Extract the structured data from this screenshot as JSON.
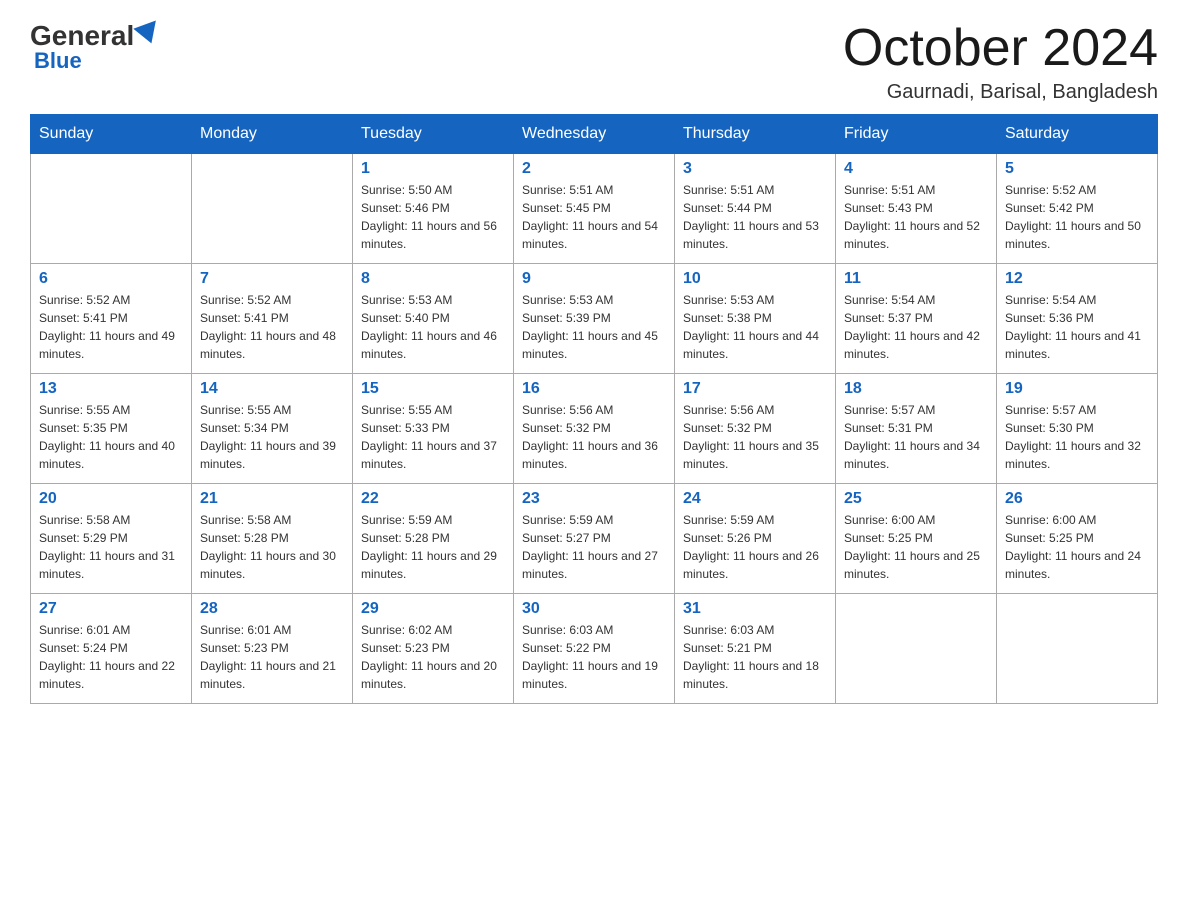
{
  "header": {
    "logo": {
      "general": "General",
      "blue": "Blue"
    },
    "title": "October 2024",
    "location": "Gaurnadi, Barisal, Bangladesh"
  },
  "weekdays": [
    "Sunday",
    "Monday",
    "Tuesday",
    "Wednesday",
    "Thursday",
    "Friday",
    "Saturday"
  ],
  "weeks": [
    [
      {
        "day": "",
        "sunrise": "",
        "sunset": "",
        "daylight": ""
      },
      {
        "day": "",
        "sunrise": "",
        "sunset": "",
        "daylight": ""
      },
      {
        "day": "1",
        "sunrise": "Sunrise: 5:50 AM",
        "sunset": "Sunset: 5:46 PM",
        "daylight": "Daylight: 11 hours and 56 minutes."
      },
      {
        "day": "2",
        "sunrise": "Sunrise: 5:51 AM",
        "sunset": "Sunset: 5:45 PM",
        "daylight": "Daylight: 11 hours and 54 minutes."
      },
      {
        "day": "3",
        "sunrise": "Sunrise: 5:51 AM",
        "sunset": "Sunset: 5:44 PM",
        "daylight": "Daylight: 11 hours and 53 minutes."
      },
      {
        "day": "4",
        "sunrise": "Sunrise: 5:51 AM",
        "sunset": "Sunset: 5:43 PM",
        "daylight": "Daylight: 11 hours and 52 minutes."
      },
      {
        "day": "5",
        "sunrise": "Sunrise: 5:52 AM",
        "sunset": "Sunset: 5:42 PM",
        "daylight": "Daylight: 11 hours and 50 minutes."
      }
    ],
    [
      {
        "day": "6",
        "sunrise": "Sunrise: 5:52 AM",
        "sunset": "Sunset: 5:41 PM",
        "daylight": "Daylight: 11 hours and 49 minutes."
      },
      {
        "day": "7",
        "sunrise": "Sunrise: 5:52 AM",
        "sunset": "Sunset: 5:41 PM",
        "daylight": "Daylight: 11 hours and 48 minutes."
      },
      {
        "day": "8",
        "sunrise": "Sunrise: 5:53 AM",
        "sunset": "Sunset: 5:40 PM",
        "daylight": "Daylight: 11 hours and 46 minutes."
      },
      {
        "day": "9",
        "sunrise": "Sunrise: 5:53 AM",
        "sunset": "Sunset: 5:39 PM",
        "daylight": "Daylight: 11 hours and 45 minutes."
      },
      {
        "day": "10",
        "sunrise": "Sunrise: 5:53 AM",
        "sunset": "Sunset: 5:38 PM",
        "daylight": "Daylight: 11 hours and 44 minutes."
      },
      {
        "day": "11",
        "sunrise": "Sunrise: 5:54 AM",
        "sunset": "Sunset: 5:37 PM",
        "daylight": "Daylight: 11 hours and 42 minutes."
      },
      {
        "day": "12",
        "sunrise": "Sunrise: 5:54 AM",
        "sunset": "Sunset: 5:36 PM",
        "daylight": "Daylight: 11 hours and 41 minutes."
      }
    ],
    [
      {
        "day": "13",
        "sunrise": "Sunrise: 5:55 AM",
        "sunset": "Sunset: 5:35 PM",
        "daylight": "Daylight: 11 hours and 40 minutes."
      },
      {
        "day": "14",
        "sunrise": "Sunrise: 5:55 AM",
        "sunset": "Sunset: 5:34 PM",
        "daylight": "Daylight: 11 hours and 39 minutes."
      },
      {
        "day": "15",
        "sunrise": "Sunrise: 5:55 AM",
        "sunset": "Sunset: 5:33 PM",
        "daylight": "Daylight: 11 hours and 37 minutes."
      },
      {
        "day": "16",
        "sunrise": "Sunrise: 5:56 AM",
        "sunset": "Sunset: 5:32 PM",
        "daylight": "Daylight: 11 hours and 36 minutes."
      },
      {
        "day": "17",
        "sunrise": "Sunrise: 5:56 AM",
        "sunset": "Sunset: 5:32 PM",
        "daylight": "Daylight: 11 hours and 35 minutes."
      },
      {
        "day": "18",
        "sunrise": "Sunrise: 5:57 AM",
        "sunset": "Sunset: 5:31 PM",
        "daylight": "Daylight: 11 hours and 34 minutes."
      },
      {
        "day": "19",
        "sunrise": "Sunrise: 5:57 AM",
        "sunset": "Sunset: 5:30 PM",
        "daylight": "Daylight: 11 hours and 32 minutes."
      }
    ],
    [
      {
        "day": "20",
        "sunrise": "Sunrise: 5:58 AM",
        "sunset": "Sunset: 5:29 PM",
        "daylight": "Daylight: 11 hours and 31 minutes."
      },
      {
        "day": "21",
        "sunrise": "Sunrise: 5:58 AM",
        "sunset": "Sunset: 5:28 PM",
        "daylight": "Daylight: 11 hours and 30 minutes."
      },
      {
        "day": "22",
        "sunrise": "Sunrise: 5:59 AM",
        "sunset": "Sunset: 5:28 PM",
        "daylight": "Daylight: 11 hours and 29 minutes."
      },
      {
        "day": "23",
        "sunrise": "Sunrise: 5:59 AM",
        "sunset": "Sunset: 5:27 PM",
        "daylight": "Daylight: 11 hours and 27 minutes."
      },
      {
        "day": "24",
        "sunrise": "Sunrise: 5:59 AM",
        "sunset": "Sunset: 5:26 PM",
        "daylight": "Daylight: 11 hours and 26 minutes."
      },
      {
        "day": "25",
        "sunrise": "Sunrise: 6:00 AM",
        "sunset": "Sunset: 5:25 PM",
        "daylight": "Daylight: 11 hours and 25 minutes."
      },
      {
        "day": "26",
        "sunrise": "Sunrise: 6:00 AM",
        "sunset": "Sunset: 5:25 PM",
        "daylight": "Daylight: 11 hours and 24 minutes."
      }
    ],
    [
      {
        "day": "27",
        "sunrise": "Sunrise: 6:01 AM",
        "sunset": "Sunset: 5:24 PM",
        "daylight": "Daylight: 11 hours and 22 minutes."
      },
      {
        "day": "28",
        "sunrise": "Sunrise: 6:01 AM",
        "sunset": "Sunset: 5:23 PM",
        "daylight": "Daylight: 11 hours and 21 minutes."
      },
      {
        "day": "29",
        "sunrise": "Sunrise: 6:02 AM",
        "sunset": "Sunset: 5:23 PM",
        "daylight": "Daylight: 11 hours and 20 minutes."
      },
      {
        "day": "30",
        "sunrise": "Sunrise: 6:03 AM",
        "sunset": "Sunset: 5:22 PM",
        "daylight": "Daylight: 11 hours and 19 minutes."
      },
      {
        "day": "31",
        "sunrise": "Sunrise: 6:03 AM",
        "sunset": "Sunset: 5:21 PM",
        "daylight": "Daylight: 11 hours and 18 minutes."
      },
      {
        "day": "",
        "sunrise": "",
        "sunset": "",
        "daylight": ""
      },
      {
        "day": "",
        "sunrise": "",
        "sunset": "",
        "daylight": ""
      }
    ]
  ]
}
